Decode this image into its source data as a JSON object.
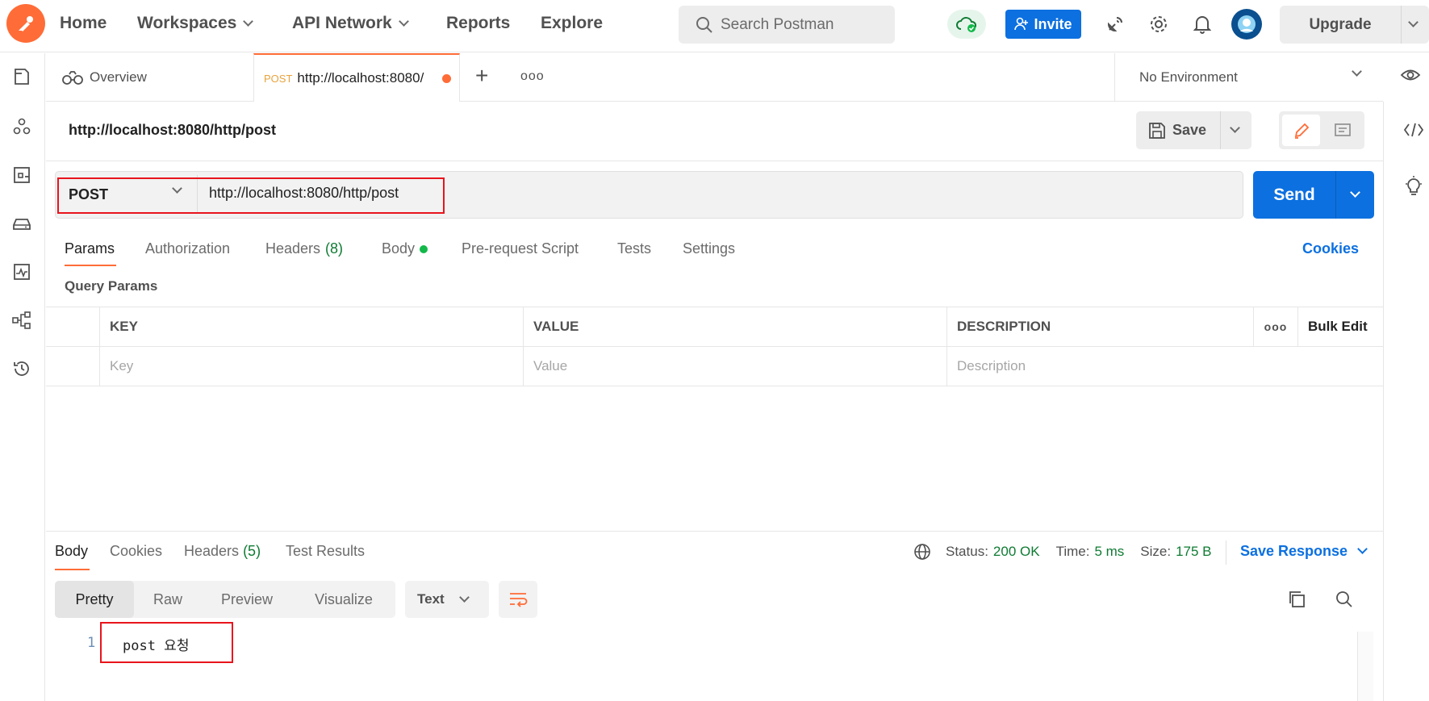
{
  "topbar": {
    "nav": [
      {
        "label": "Home"
      },
      {
        "label": "Workspaces"
      },
      {
        "label": "API Network"
      },
      {
        "label": "Reports"
      },
      {
        "label": "Explore"
      }
    ],
    "search_placeholder": "Search Postman",
    "invite_label": "Invite",
    "upgrade_label": "Upgrade",
    "brand_color": "#ff6c37"
  },
  "tabs": {
    "overview_label": "Overview",
    "active_method": "POST",
    "active_url": "http://localhost:8080/",
    "environment": "No Environment"
  },
  "request": {
    "title": "http://localhost:8080/http/post",
    "save_label": "Save",
    "method": "POST",
    "url": "http://localhost:8080/http/post",
    "send_label": "Send",
    "tabs": [
      {
        "label": "Params"
      },
      {
        "label": "Authorization"
      },
      {
        "label": "Headers",
        "count": "(8)"
      },
      {
        "label": "Body"
      },
      {
        "label": "Pre-request Script"
      },
      {
        "label": "Tests"
      },
      {
        "label": "Settings"
      }
    ],
    "cookies_label": "Cookies",
    "query_params_label": "Query Params",
    "table": {
      "headers": [
        "KEY",
        "VALUE",
        "DESCRIPTION"
      ],
      "bulk_edit": "Bulk Edit",
      "placeholders": [
        "Key",
        "Value",
        "Description"
      ]
    }
  },
  "response": {
    "tabs": [
      {
        "label": "Body"
      },
      {
        "label": "Cookies"
      },
      {
        "label": "Headers",
        "count": "(5)"
      },
      {
        "label": "Test Results"
      }
    ],
    "status_label": "Status:",
    "status_value": "200 OK",
    "time_label": "Time:",
    "time_value": "5 ms",
    "size_label": "Size:",
    "size_value": "175 B",
    "save_response_label": "Save Response",
    "views": [
      "Pretty",
      "Raw",
      "Preview",
      "Visualize"
    ],
    "format": "Text",
    "line_number": "1",
    "body_text": "post 요청"
  },
  "colors": {
    "accent": "#0c70e0",
    "highlight": "#e8141c",
    "success": "#0f7b33"
  }
}
